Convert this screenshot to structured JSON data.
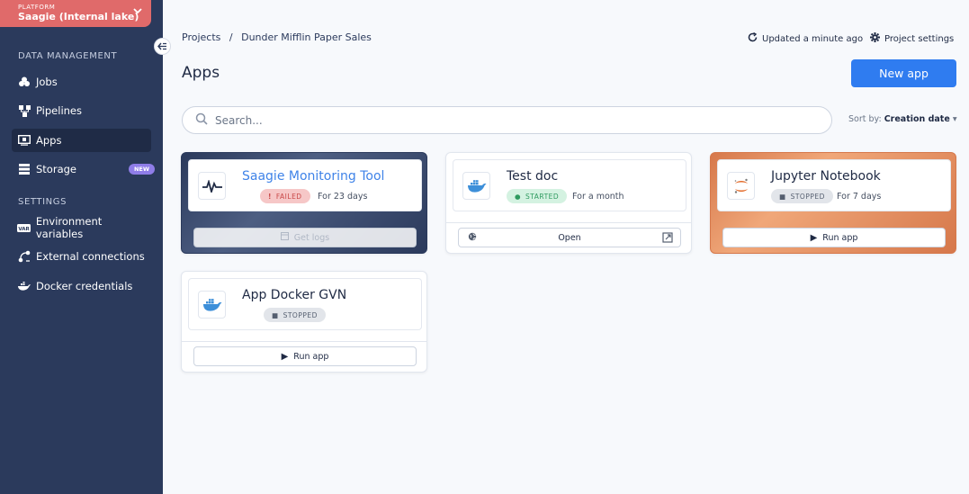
{
  "platform": {
    "label": "PLATFORM",
    "name": "Saagie (Internal lake)"
  },
  "sidebar": {
    "section_data": "DATA MANAGEMENT",
    "section_settings": "SETTINGS",
    "items": [
      {
        "label": "Jobs",
        "icon": "jobs-icon"
      },
      {
        "label": "Pipelines",
        "icon": "pipelines-icon"
      },
      {
        "label": "Apps",
        "icon": "apps-icon",
        "active": true
      },
      {
        "label": "Storage",
        "icon": "storage-icon",
        "badge": "NEW"
      },
      {
        "label": "Environment variables",
        "icon": "env-var-icon"
      },
      {
        "label": "External connections",
        "icon": "external-connections-icon"
      },
      {
        "label": "Docker credentials",
        "icon": "docker-credentials-icon"
      }
    ]
  },
  "breadcrumb": {
    "root": "Projects",
    "separator": "/",
    "current": "Dunder Mifflin Paper Sales"
  },
  "header": {
    "updated": "Updated a minute ago",
    "settings": "Project settings",
    "title": "Apps",
    "new_app": "New app"
  },
  "search": {
    "placeholder": "Search..."
  },
  "sort": {
    "label": "Sort by:",
    "value": "Creation date"
  },
  "apps": [
    {
      "name": "Saagie Monitoring Tool",
      "status": "FAILED",
      "since": "For 23 days",
      "action": "Get logs",
      "theme": "dark"
    },
    {
      "name": "Test doc",
      "status": "STARTED",
      "since": "For a month",
      "action": "Open",
      "theme": "light"
    },
    {
      "name": "Jupyter Notebook",
      "status": "STOPPED",
      "since": "For 7 days",
      "action": "Run app",
      "theme": "orange"
    },
    {
      "name": "App Docker GVN",
      "status": "STOPPED",
      "since": "",
      "action": "Run app",
      "theme": "light"
    }
  ],
  "colors": {
    "sidebar": "#2b3a5c",
    "platform": "#e06a6a",
    "primary": "#2f7cf0",
    "failed": "#c94848",
    "started": "#2e9a5f",
    "new_badge": "#8f7de8"
  }
}
